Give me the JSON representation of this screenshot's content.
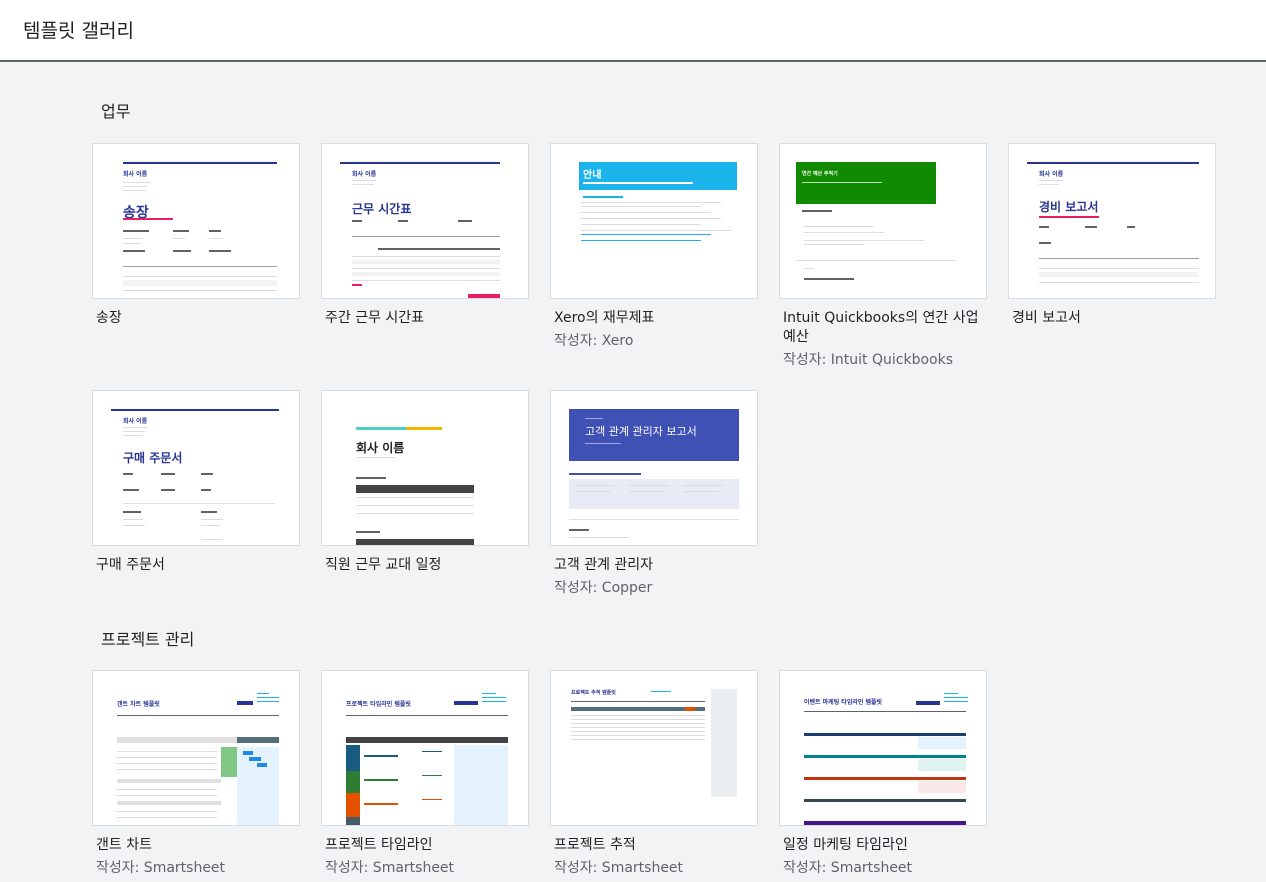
{
  "header": {
    "title": "템플릿 갤러리"
  },
  "sections": {
    "work": {
      "title": "업무",
      "templates": [
        {
          "name": "송장",
          "author": ""
        },
        {
          "name": "주간 근무 시간표",
          "author": ""
        },
        {
          "name": "Xero의 재무제표",
          "author": "작성자: Xero"
        },
        {
          "name": "Intuit Quickbooks의 연간 사업 예산",
          "author": "작성자: Intuit Quickbooks"
        },
        {
          "name": "경비 보고서",
          "author": ""
        },
        {
          "name": "구매 주문서",
          "author": ""
        },
        {
          "name": "직원 근무 교대 일정",
          "author": ""
        },
        {
          "name": "고객 관계 관리자",
          "author": "작성자: Copper"
        }
      ]
    },
    "project": {
      "title": "프로젝트 관리",
      "templates": [
        {
          "name": "갠트 차트",
          "author": "작성자: Smartsheet"
        },
        {
          "name": "프로젝트 타임라인",
          "author": "작성자: Smartsheet"
        },
        {
          "name": "프로젝트 추적",
          "author": "작성자: Smartsheet"
        },
        {
          "name": "일정 마케팅 타임라인",
          "author": "작성자: Smartsheet"
        }
      ]
    }
  },
  "thumbnails": {
    "invoice_heading": "송장",
    "invoice_company": "회사 이름",
    "timesheet_heading": "근무 시간표",
    "timesheet_company": "회사 이름",
    "xero_heading": "안내",
    "intuit_heading": "연간 예산 추적기",
    "expense_heading": "경비 보고서",
    "expense_company": "회사 이름",
    "po_heading": "구매 주문서",
    "po_company": "회사 이름",
    "shift_heading": "회사 이름",
    "crm_heading": "고객 관계 관리자 보고서",
    "gantt_heading": "갠트 차트 템플릿",
    "timeline_heading": "프로젝트 타임라인 템플릿",
    "tracker_heading": "프로젝트 추적 템플릿",
    "marketing_heading": "이벤트 마케팅 타임라인 템플릿"
  },
  "colors": {
    "navy": "#283593",
    "xero_blue": "#1ab4ea",
    "intuit_green": "#108a00",
    "crm_blue": "#3f51b5"
  }
}
